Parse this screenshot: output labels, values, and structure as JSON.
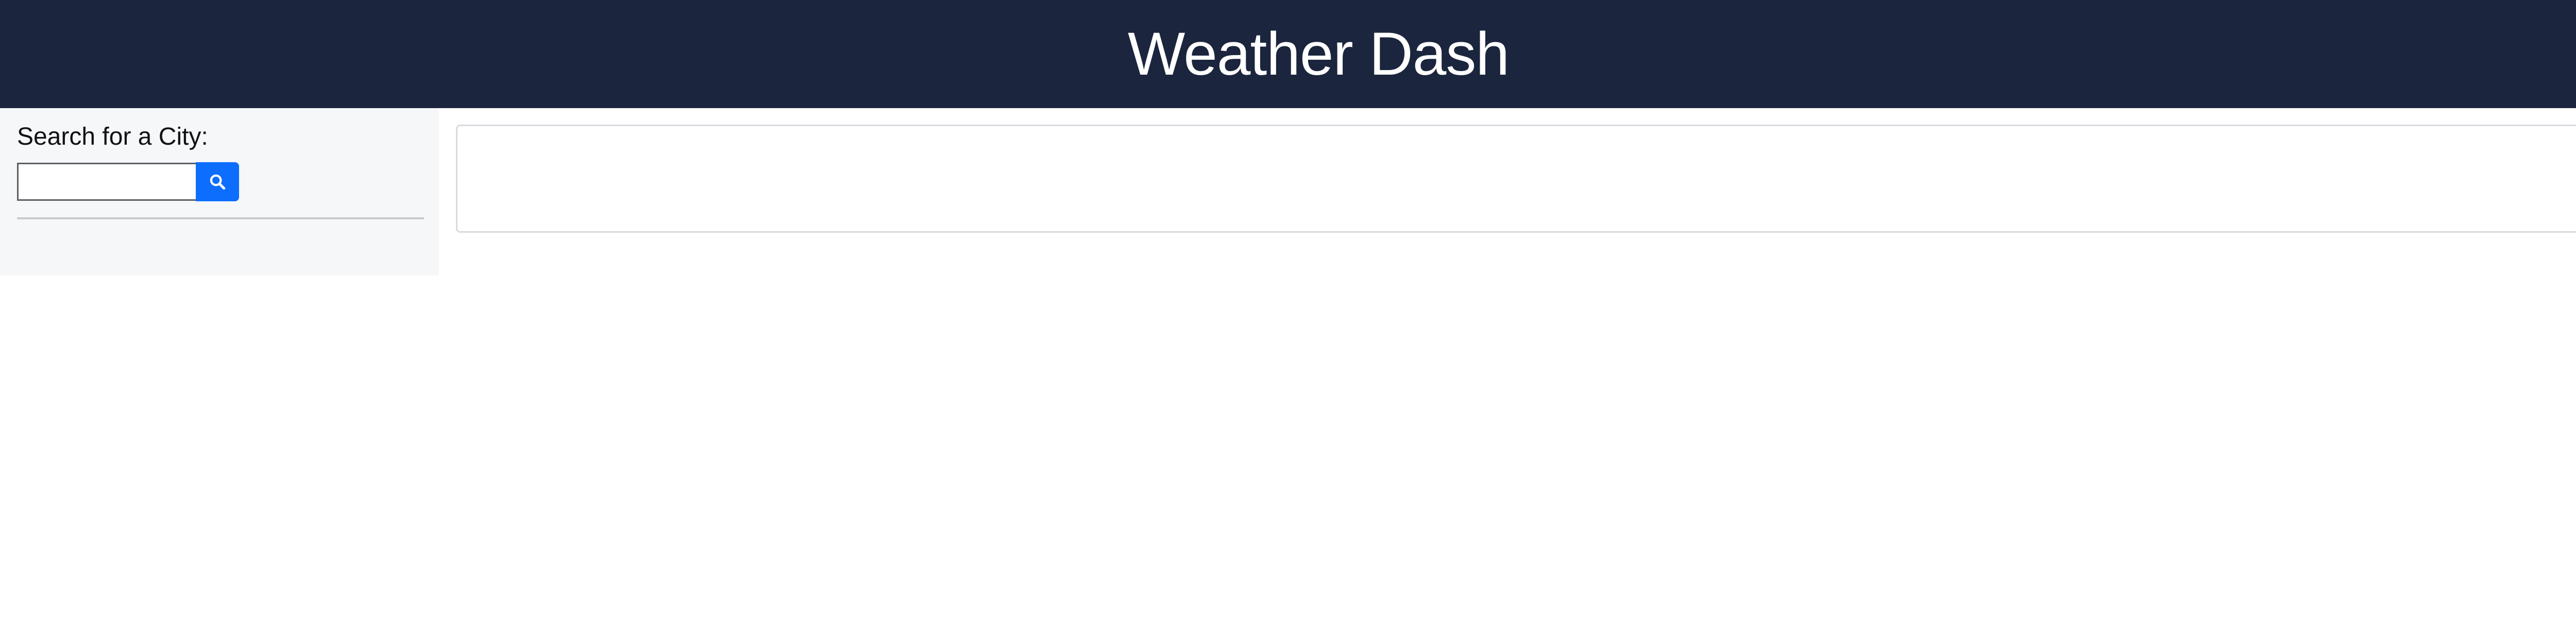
{
  "header": {
    "title": "Weather Dash",
    "background": "#1b253d"
  },
  "sidebar": {
    "search_label": "Search for a City:",
    "search_input_value": "",
    "search_input_placeholder": "",
    "search_button_icon": "search-icon",
    "accent": "#0d6efd"
  },
  "main": {
    "results_card_text": ""
  }
}
